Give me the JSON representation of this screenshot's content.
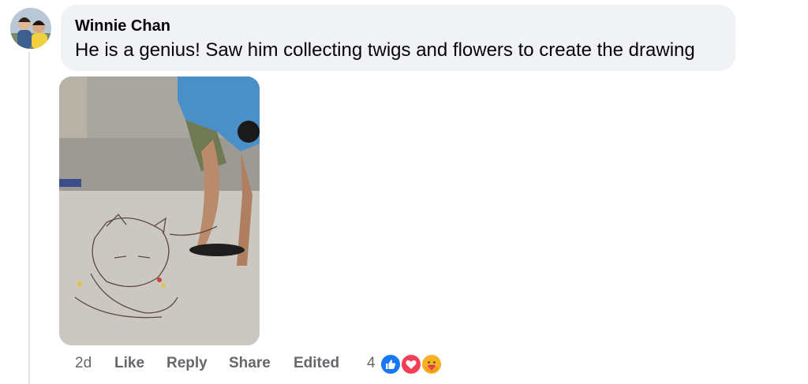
{
  "comment": {
    "author": "Winnie Chan",
    "text": "He is a genius! Saw him collecting twigs and flowers to create the drawing"
  },
  "actions": {
    "time": "2d",
    "like": "Like",
    "reply": "Reply",
    "share": "Share",
    "edited": "Edited"
  },
  "reactions": {
    "count": "4",
    "types": [
      "like-icon",
      "love-icon",
      "care-icon"
    ],
    "colors": {
      "like": "#1877f2",
      "love": "#f33e58",
      "care": "#f7b125"
    }
  },
  "colors": {
    "bubble": "#f0f2f5",
    "secondary_text": "#65676b",
    "primary_text": "#050505"
  }
}
